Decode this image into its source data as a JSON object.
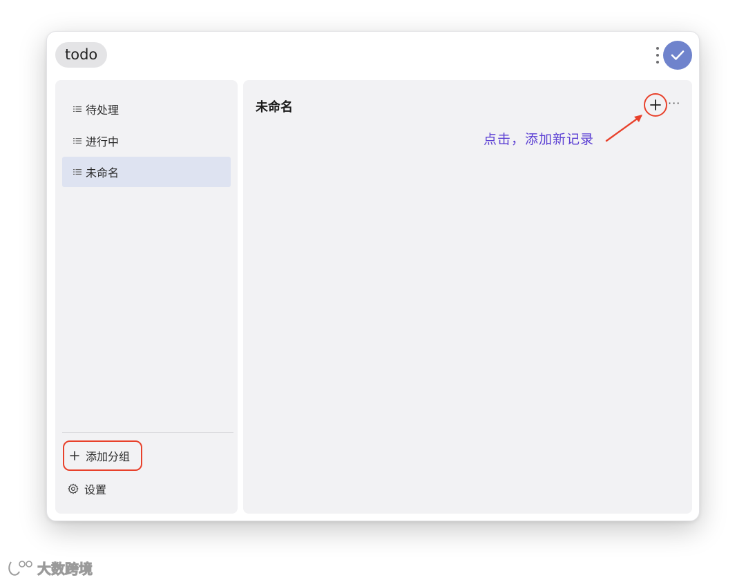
{
  "window": {
    "title": "todo"
  },
  "header": {
    "more_icon": "vertical-ellipsis-icon",
    "confirm_icon": "checkmark-icon",
    "confirm_color": "#6f83cc"
  },
  "sidebar": {
    "items": [
      {
        "label": "待处理",
        "icon": "list-icon",
        "active": false
      },
      {
        "label": "进行中",
        "icon": "list-icon",
        "active": false
      },
      {
        "label": "未命名",
        "icon": "list-icon",
        "active": true
      }
    ],
    "add_group_label": "添加分组",
    "settings_label": "设置"
  },
  "main": {
    "title": "未命名",
    "add_icon": "plus-icon",
    "more_label": "···"
  },
  "annotation": {
    "text": "点击，添加新记录",
    "color": "#5b3fd3",
    "highlight_color": "#e8412b"
  },
  "watermark": {
    "text": "大数跨境"
  }
}
